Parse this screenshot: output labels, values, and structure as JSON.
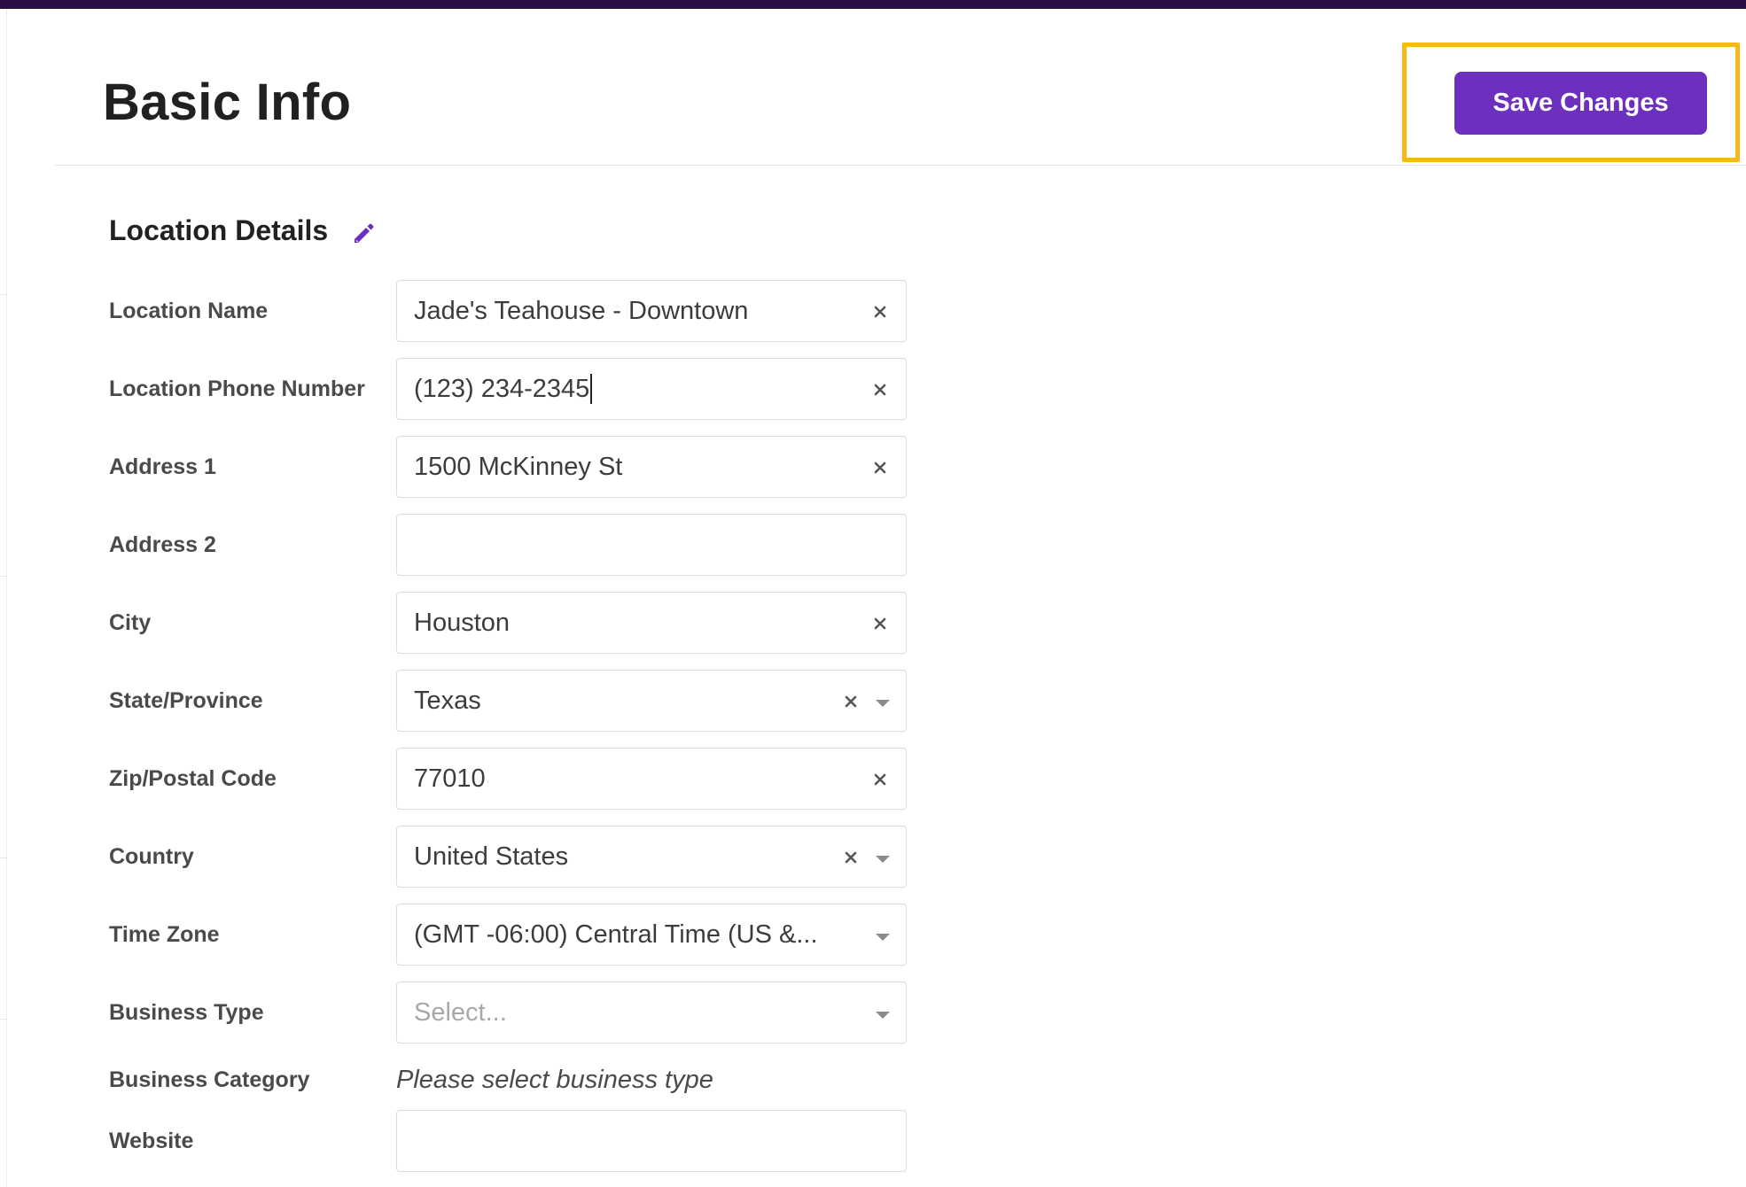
{
  "header": {
    "title": "Basic Info",
    "save_label": "Save Changes"
  },
  "section": {
    "title": "Location Details"
  },
  "fields": {
    "location_name": {
      "label": "Location Name",
      "value": "Jade's Teahouse - Downtown"
    },
    "phone": {
      "label": "Location Phone Number",
      "value": "(123) 234-2345"
    },
    "address1": {
      "label": "Address 1",
      "value": "1500 McKinney St"
    },
    "address2": {
      "label": "Address 2",
      "value": ""
    },
    "city": {
      "label": "City",
      "value": "Houston"
    },
    "state": {
      "label": "State/Province",
      "value": "Texas"
    },
    "zip": {
      "label": "Zip/Postal Code",
      "value": "77010"
    },
    "country": {
      "label": "Country",
      "value": "United States"
    },
    "timezone": {
      "label": "Time Zone",
      "value": "(GMT -06:00) Central Time (US &..."
    },
    "business_type": {
      "label": "Business Type",
      "placeholder": "Select..."
    },
    "business_category": {
      "label": "Business Category",
      "helper": "Please select business type"
    },
    "website": {
      "label": "Website",
      "value": ""
    }
  },
  "colors": {
    "accent": "#6d2fbe",
    "highlight": "#f6b917",
    "top_bar": "#2b0d47"
  }
}
